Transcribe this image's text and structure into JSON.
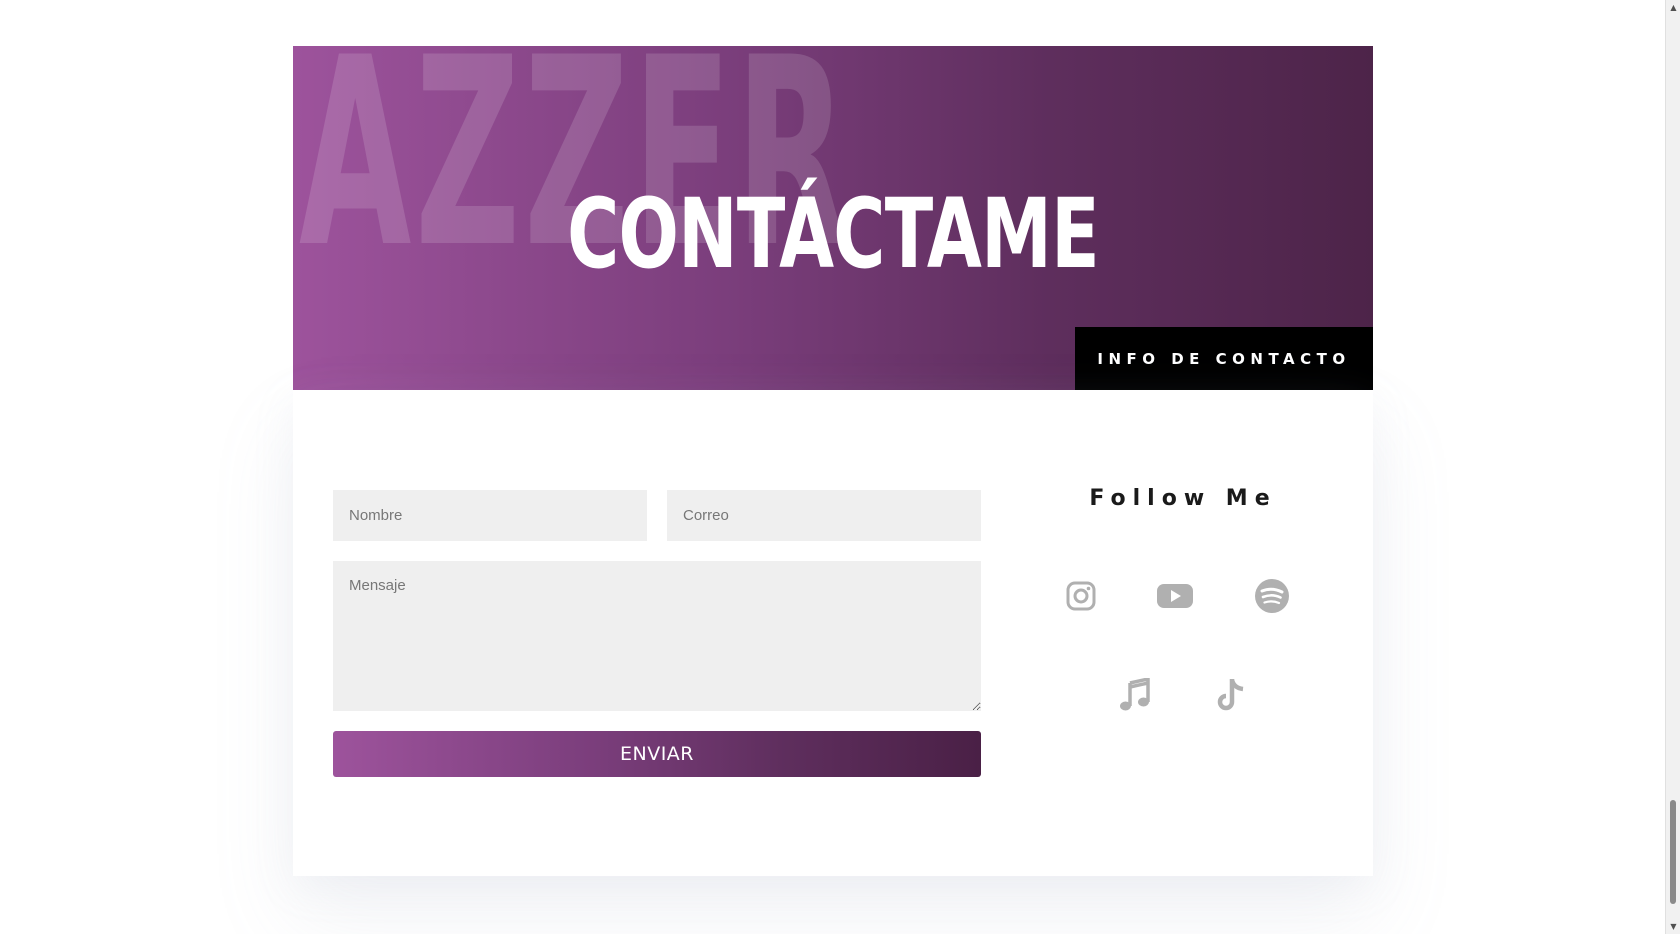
{
  "hero": {
    "watermark": "AZZER",
    "title": "CONTÁCTAME",
    "tab_label": "INFO DE CONTACTO"
  },
  "form": {
    "name_placeholder": "Nombre",
    "email_placeholder": "Correo",
    "message_placeholder": "Mensaje",
    "submit_label": "ENVIAR"
  },
  "social": {
    "title": "Follow Me",
    "icons": [
      "instagram-icon",
      "youtube-icon",
      "spotify-icon",
      "music-note-icon",
      "tiktok-icon"
    ],
    "icon_color": "#b0b0b0"
  },
  "colors": {
    "gradient_start": "#9d539c",
    "gradient_end": "#4d2449",
    "tab_bg": "#000000"
  }
}
